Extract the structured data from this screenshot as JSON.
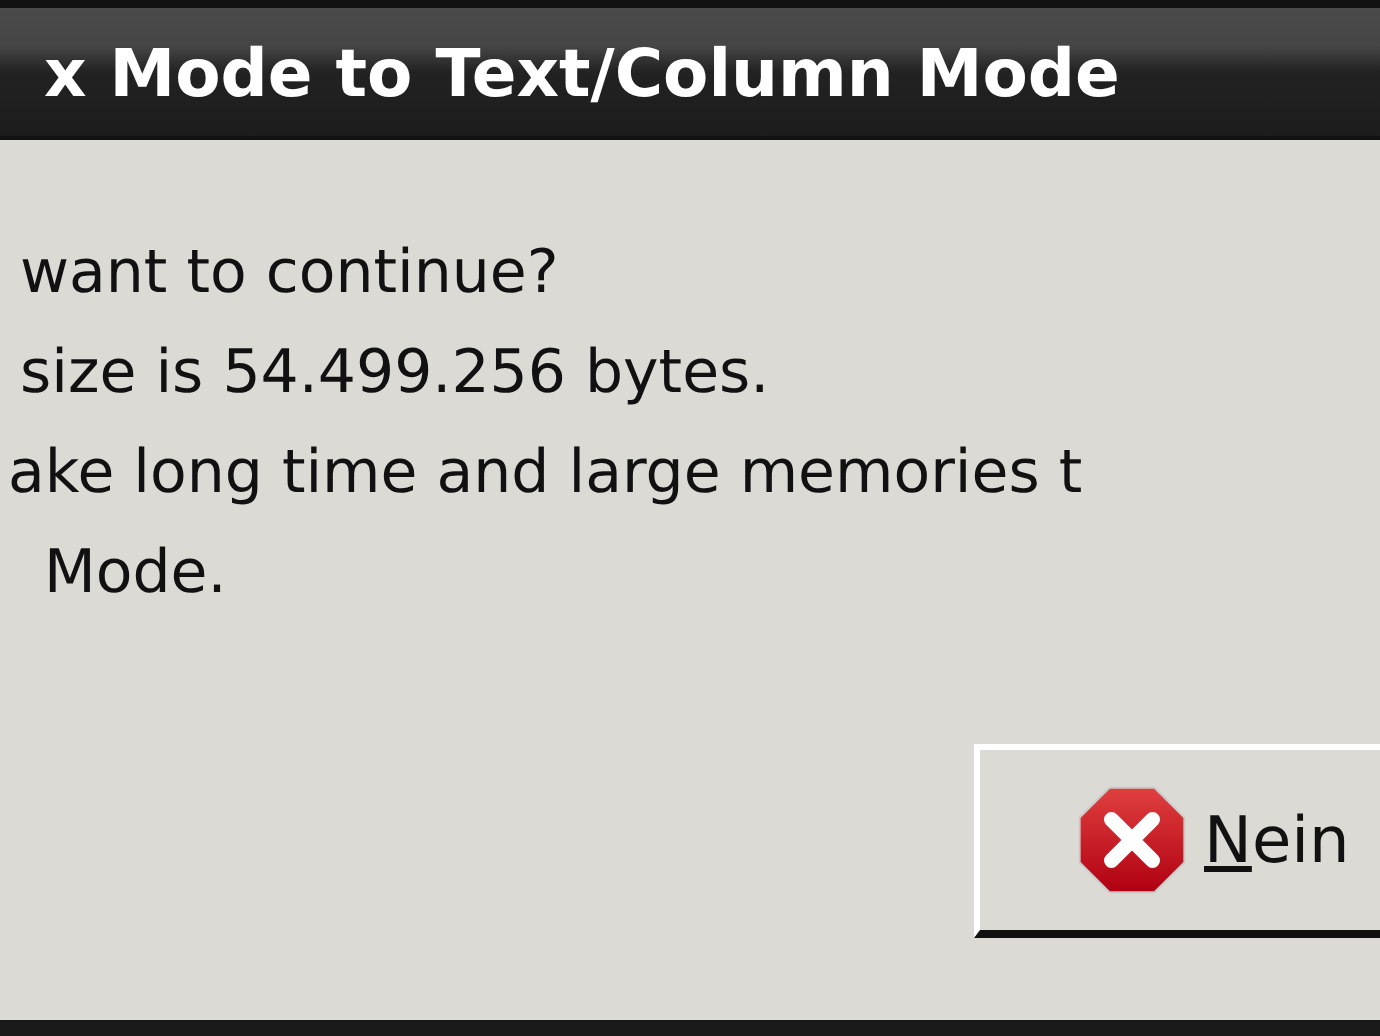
{
  "window": {
    "title": "x Mode to Text/Column Mode"
  },
  "message": [
    "want to continue?",
    "size is 54.499.256 bytes.",
    "ake long time and large memories t",
    "Mode."
  ],
  "buttons": [
    {
      "label": "Nein",
      "kind": "no"
    }
  ]
}
